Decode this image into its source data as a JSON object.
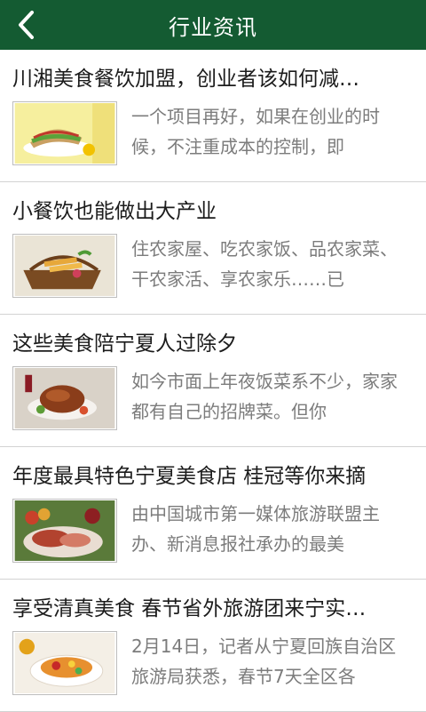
{
  "header": {
    "title": "行业资讯",
    "back_icon": "chevron-left-icon"
  },
  "articles": [
    {
      "title": "川湘美食餐饮加盟，创业者该如何减…",
      "summary": "一个项目再好，如果在创业的时候，不注重成本的控制，即",
      "image": "sandwich-plate-image"
    },
    {
      "title": "小餐饮也能做出大产业",
      "summary": "住农家屋、吃农家饭、品农家菜、干农家活、享农家乐……已",
      "image": "fried-snack-basket-image"
    },
    {
      "title": "这些美食陪宁夏人过除夕",
      "summary": "如今市面上年夜饭菜系不少，家家都有自己的招牌菜。但你",
      "image": "roast-meat-dinner-image"
    },
    {
      "title": "年度最具特色宁夏美食店 桂冠等你来摘",
      "summary": "由中国城市第一媒体旅游联盟主办、新消息报社承办的最美",
      "image": "ham-platter-image"
    },
    {
      "title": "享受清真美食 春节省外旅游团来宁实…",
      "summary": "2月14日，记者从宁夏回族自治区旅游局获悉，春节7天全区各",
      "image": "colorful-dish-image"
    }
  ]
}
